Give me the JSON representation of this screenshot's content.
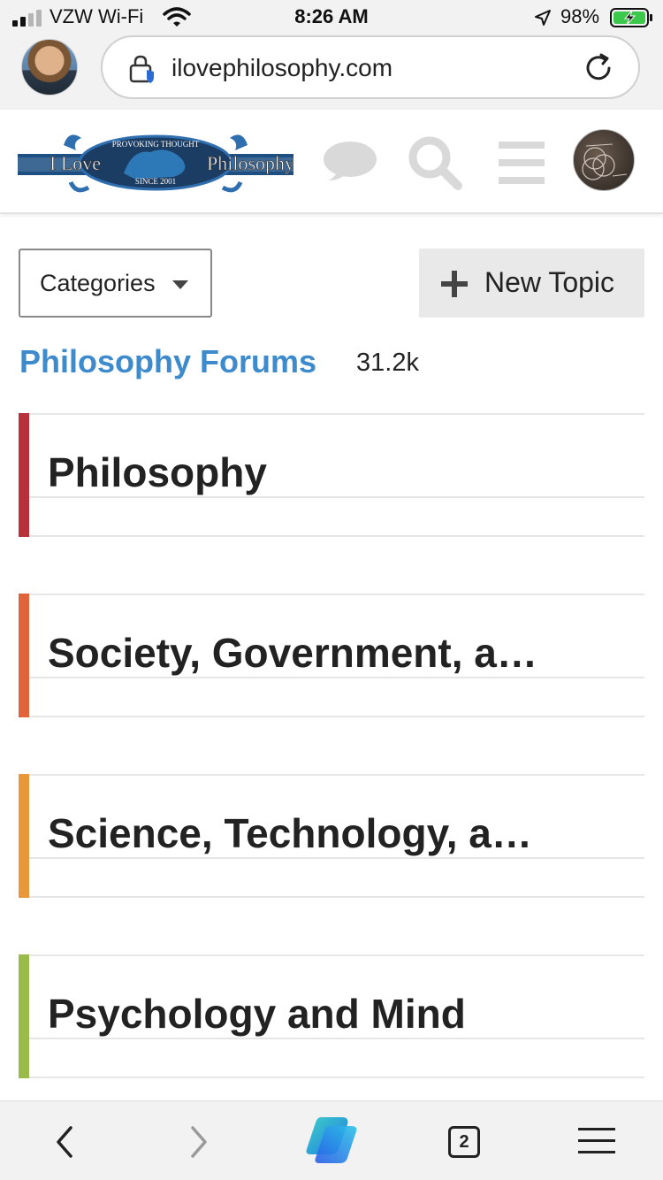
{
  "status_bar": {
    "carrier": "VZW Wi-Fi",
    "time": "8:26 AM",
    "battery": "98%"
  },
  "browser": {
    "url": "ilovephilosophy.com",
    "open_tabs": "2"
  },
  "site": {
    "logo_left_text": "I Love",
    "logo_right_text": "Philosophy",
    "logo_arc_top": "PROVOKING THOUGHT",
    "logo_arc_bottom": "SINCE 2001",
    "accent_color": "#3d8bcd"
  },
  "controls": {
    "categories_label": "Categories",
    "new_topic_label": "New Topic"
  },
  "forum": {
    "title": "Philosophy Forums",
    "count": "31.2k"
  },
  "categories": [
    {
      "title": "Philosophy",
      "color": "#b8313a"
    },
    {
      "title": "Society, Government, a…",
      "color": "#e0633a"
    },
    {
      "title": "Science, Technology, a…",
      "color": "#e8973a"
    },
    {
      "title": "Psychology and Mind",
      "color": "#9bbb48"
    }
  ],
  "toolbar": {
    "icons": [
      "back-icon",
      "forward-icon",
      "copilot-icon",
      "tabs-icon",
      "menu-icon"
    ]
  }
}
